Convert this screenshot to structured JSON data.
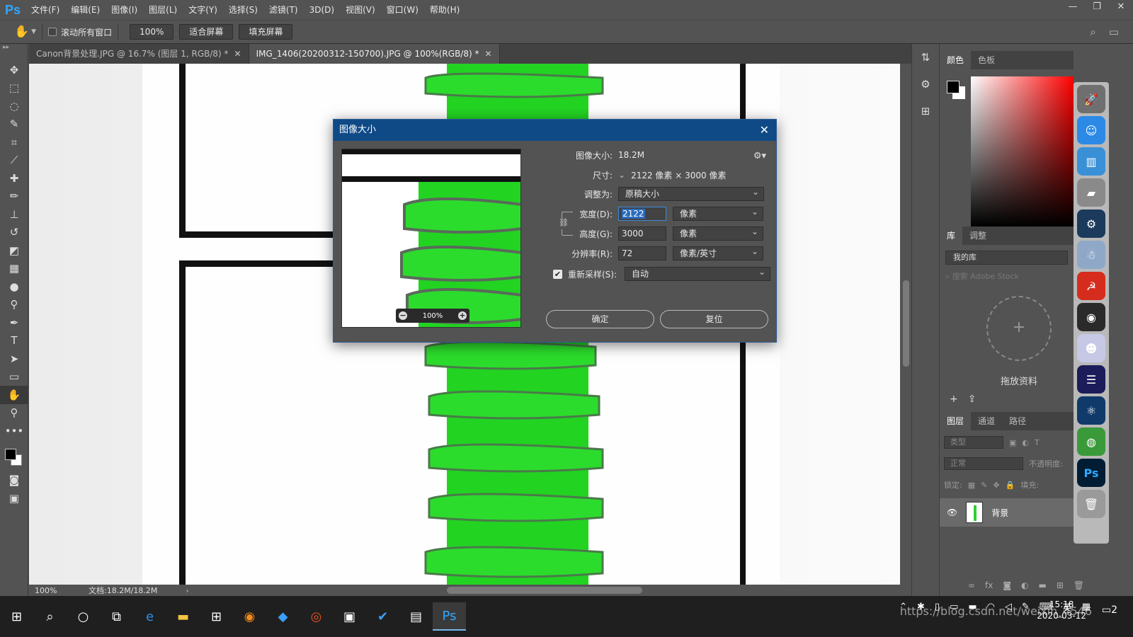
{
  "app": {
    "logo": "Ps",
    "menu": [
      "文件(F)",
      "编辑(E)",
      "图像(I)",
      "图层(L)",
      "文字(Y)",
      "选择(S)",
      "滤镜(T)",
      "3D(D)",
      "视图(V)",
      "窗口(W)",
      "帮助(H)"
    ],
    "window_controls": [
      "—",
      "❐",
      "✕"
    ]
  },
  "options": {
    "scroll_all": "滚动所有窗口",
    "zoom": "100%",
    "fit_screen": "适合屏幕",
    "fill_screen": "填充屏幕"
  },
  "tabs": [
    {
      "label": "Canon背景处理.JPG @ 16.7% (图层 1, RGB/8) *",
      "active": false
    },
    {
      "label": "IMG_1406(20200312-150700).JPG @ 100%(RGB/8) *",
      "active": true
    }
  ],
  "status": {
    "zoom": "100%",
    "doc": "文档:18.2M/18.2M"
  },
  "dialog": {
    "title": "图像大小",
    "image_size_label": "图像大小:",
    "image_size_value": "18.2M",
    "dimensions_label": "尺寸:",
    "dimensions_value": "2122 像素  ×  3000 像素",
    "fit_to_label": "调整为:",
    "fit_to_value": "原稿大小",
    "width_label": "宽度(D):",
    "width_value": "2122",
    "width_unit": "像素",
    "height_label": "高度(G):",
    "height_value": "3000",
    "height_unit": "像素",
    "resolution_label": "分辨率(R):",
    "resolution_value": "72",
    "resolution_unit": "像素/英寸",
    "resample_label": "重新采样(S):",
    "resample_checked": true,
    "resample_value": "自动",
    "preview_zoom": "100%",
    "ok_label": "确定",
    "reset_label": "复位"
  },
  "right_panel": {
    "color_tabs": [
      "颜色",
      "色板"
    ],
    "lib_tabs": [
      "库",
      "调整"
    ],
    "library_select": "我的库",
    "search_placeholder": "搜索 Adobe Stock",
    "drop_label": "拖放资料",
    "layer_tabs": [
      "图层",
      "通道",
      "路径"
    ],
    "layer_kind": "类型",
    "blend_mode": "正常",
    "opacity_label": "不透明度:",
    "lock_label": "锁定:",
    "fill_label": "填充:",
    "layer_name": "背景"
  },
  "taskbar": {
    "time": "15:18",
    "date": "2020-03-12",
    "ime": "英",
    "watermark": "https://blog.csdn.net/weixin_4546",
    "notification_count": "2"
  },
  "colors": {
    "ps_blue": "#31a8ff",
    "dialog_title": "#0f4a87",
    "green": "#2fd02f"
  }
}
